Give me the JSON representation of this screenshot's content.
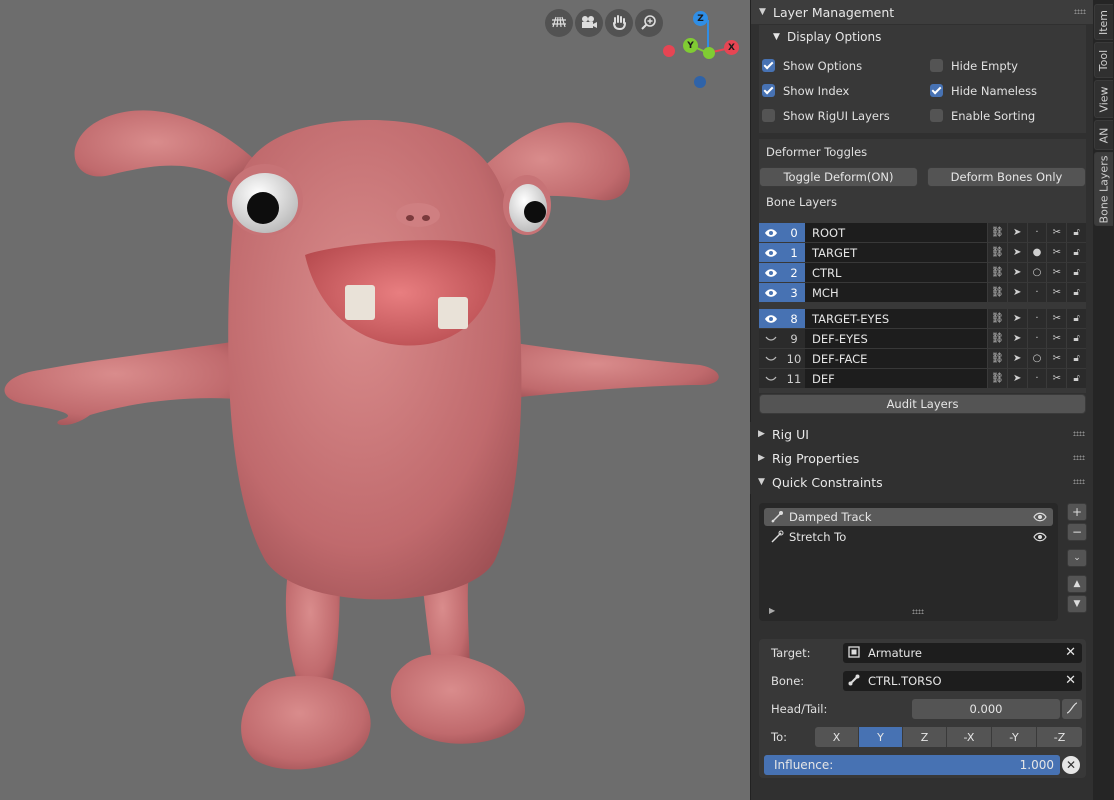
{
  "viewport": {
    "nav_icons": [
      "grid-view-icon",
      "camera-icon",
      "hand-icon",
      "zoom-icon"
    ],
    "gizmo": {
      "z": "Z",
      "y": "Y",
      "x": "X"
    }
  },
  "tabs": [
    "Item",
    "Tool",
    "View",
    "AN",
    "Bone Layers"
  ],
  "layer_management": {
    "title": "Layer Management",
    "display_options": {
      "title": "Display Options",
      "checks": [
        {
          "label": "Show Options",
          "checked": true
        },
        {
          "label": "Hide Empty",
          "checked": false
        },
        {
          "label": "Show Index",
          "checked": true
        },
        {
          "label": "Hide Nameless",
          "checked": true
        },
        {
          "label": "Show RigUI Layers",
          "checked": false
        },
        {
          "label": "Enable Sorting",
          "checked": false
        }
      ]
    },
    "deformer_toggles": {
      "title": "Deformer Toggles",
      "toggle_deform": "Toggle Deform(ON)",
      "deform_bones_only": "Deform Bones Only"
    },
    "bone_layers": {
      "title": "Bone Layers",
      "rows": [
        {
          "index": "0",
          "name": "ROOT",
          "visible": true
        },
        {
          "index": "1",
          "name": "TARGET",
          "visible": true
        },
        {
          "index": "2",
          "name": "CTRL",
          "visible": true
        },
        {
          "index": "3",
          "name": "MCH",
          "visible": true
        },
        {
          "index": "8",
          "name": "TARGET-EYES",
          "visible": true
        },
        {
          "index": "9",
          "name": "DEF-EYES",
          "visible": false
        },
        {
          "index": "10",
          "name": "DEF-FACE",
          "visible": false
        },
        {
          "index": "11",
          "name": "DEF",
          "visible": false
        }
      ]
    },
    "audit_layers": "Audit Layers"
  },
  "rig_ui": {
    "title": "Rig UI"
  },
  "rig_properties": {
    "title": "Rig Properties"
  },
  "quick_constraints": {
    "title": "Quick Constraints",
    "items": [
      {
        "label": "Damped Track",
        "selected": true
      },
      {
        "label": "Stretch To",
        "selected": false
      }
    ],
    "target_label": "Target:",
    "target_value": "Armature",
    "bone_label": "Bone:",
    "bone_value": "CTRL.TORSO",
    "headtail_label": "Head/Tail:",
    "headtail_value": "0.000",
    "to_label": "To:",
    "to_axes": [
      "X",
      "Y",
      "Z",
      "-X",
      "-Y",
      "-Z"
    ],
    "to_selected": "Y",
    "influence_label": "Influence:",
    "influence_value": "1.000",
    "influence_fraction": 1.0
  }
}
